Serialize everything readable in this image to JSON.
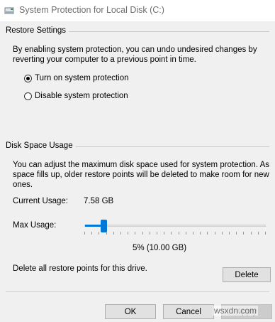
{
  "window": {
    "title": "System Protection for Local Disk (C:)",
    "icon": "drive-protection-icon"
  },
  "restore_settings": {
    "heading": "Restore Settings",
    "description_line1": "By enabling system protection, you can undo undesired changes by",
    "description_line2": "reverting your computer to a previous point in time.",
    "options": [
      {
        "label": "Turn on system protection",
        "selected": true
      },
      {
        "label": "Disable system protection",
        "selected": false
      }
    ]
  },
  "disk_space": {
    "heading": "Disk Space Usage",
    "description_line1": "You can adjust the maximum disk space used for system protection. As",
    "description_line2": "space fills up, older restore points will be deleted to make room for new",
    "description_line3": "ones.",
    "current_usage_label": "Current Usage:",
    "current_usage_value": "7.58 GB",
    "max_usage_label": "Max Usage:",
    "max_usage_percent": 5,
    "max_usage_text": "5% (10.00 GB)",
    "delete_text": "Delete all restore points for this drive.",
    "delete_label": "Delete"
  },
  "footer": {
    "ok_label": "OK",
    "cancel_label": "Cancel",
    "apply_label": "Apply"
  },
  "watermark": "wsxdn.com",
  "colors": {
    "accent": "#0078d7",
    "background": "#f0f0f0"
  }
}
